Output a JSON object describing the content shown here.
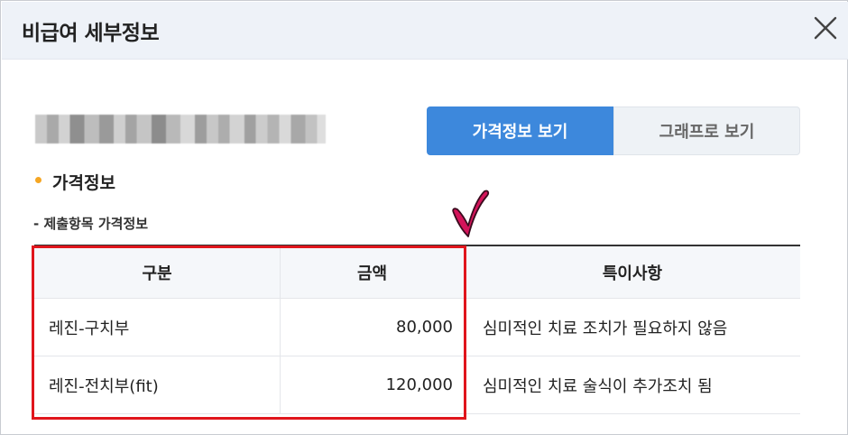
{
  "dialog": {
    "title": "비급여 세부정보",
    "close_icon": "close-icon"
  },
  "view_toggle": {
    "price_label": "가격정보 보기",
    "graph_label": "그래프로 보기",
    "active": "price"
  },
  "section": {
    "title": "가격정보",
    "subtitle": "- 제출항목 가격정보"
  },
  "table": {
    "headers": [
      "구분",
      "금액",
      "특이사항"
    ],
    "rows": [
      [
        "레진-구치부",
        "80,000",
        "심미적인 치료 조치가 필요하지 않음"
      ],
      [
        "레진-전치부(fit)",
        "120,000",
        "심미적인 치료 술식이 추가조치 됨"
      ]
    ]
  },
  "annotations": {
    "highlight_color": "#e0151c",
    "check_color": "#d4145a",
    "check_icon": "heart-check-icon"
  },
  "colors": {
    "accent": "#3d88dc",
    "bullet": "#f5a623"
  }
}
